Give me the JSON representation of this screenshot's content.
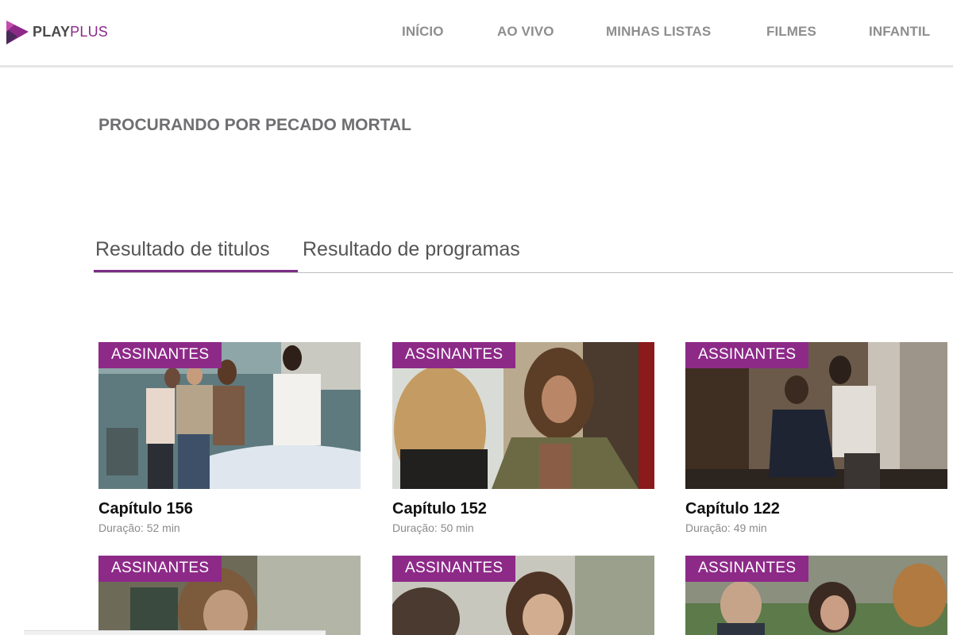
{
  "header": {
    "logo": {
      "part1": "PLAY",
      "part2": "PLUS"
    },
    "nav": [
      "INÍCIO",
      "AO VIVO",
      "MINHAS LISTAS",
      "FILMES",
      "INFANTIL"
    ]
  },
  "search": {
    "title": "PROCURANDO POR PECADO MORTAL"
  },
  "tabs": [
    "Resultado de titulos",
    "Resultado de programas"
  ],
  "results": [
    {
      "badge": "ASSINANTES",
      "title": "Capítulo 156",
      "duration": "Duração: 52 min"
    },
    {
      "badge": "ASSINANTES",
      "title": "Capítulo 152",
      "duration": "Duração: 50 min"
    },
    {
      "badge": "ASSINANTES",
      "title": "Capítulo 122",
      "duration": "Duração: 49 min"
    },
    {
      "badge": "ASSINANTES"
    },
    {
      "badge": "ASSINANTES"
    },
    {
      "badge": "ASSINANTES"
    }
  ],
  "colors": {
    "accent": "#8d2a88",
    "nav_text": "#8e8e8e",
    "heading": "#6f6f72"
  }
}
